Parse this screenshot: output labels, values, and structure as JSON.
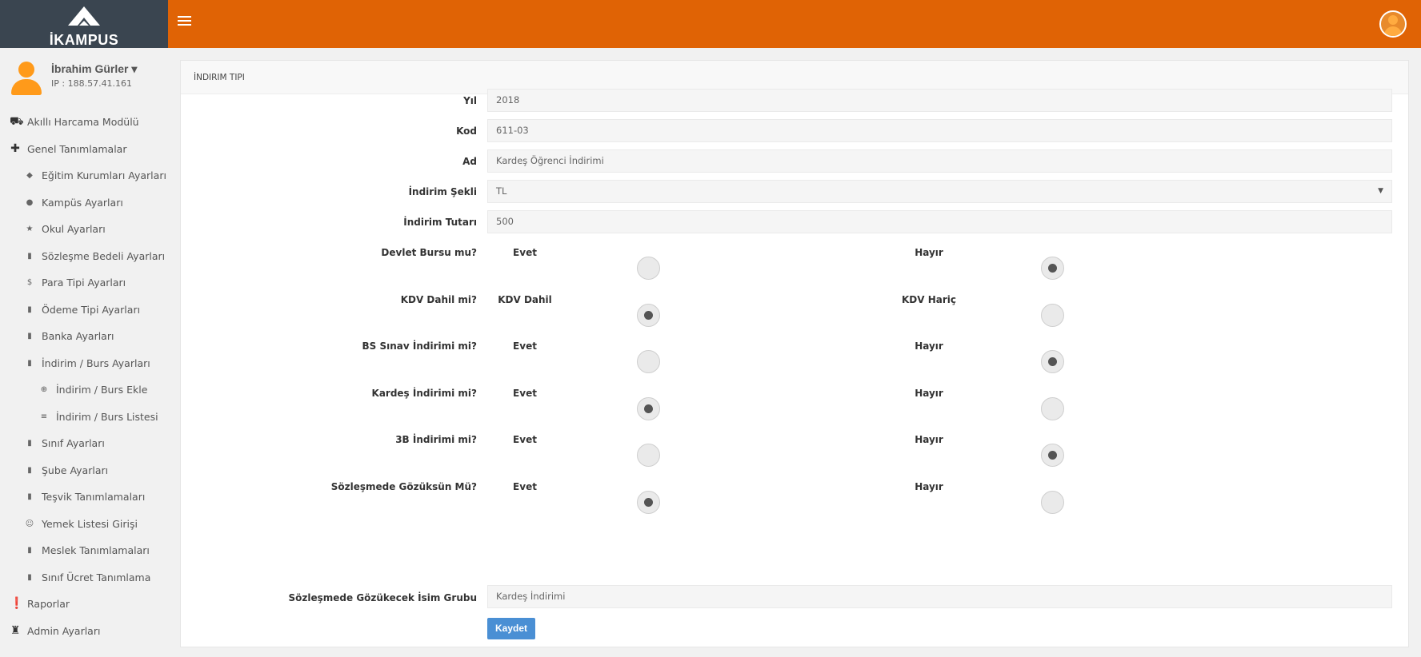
{
  "app": {
    "logo_text": "İKAMPUS"
  },
  "user": {
    "name": "İbrahim Gürler ▾",
    "ip": "IP : 188.57.41.161"
  },
  "sidebar": {
    "items": [
      {
        "label": "Akıllı Harcama Modülü",
        "icon": "basket-icon",
        "glyph": "⛟",
        "level": 0
      },
      {
        "label": "Genel Tanımlamalar",
        "icon": "puzzle-icon",
        "glyph": "✚",
        "level": 0
      },
      {
        "label": "Eğitim Kurumları Ayarları",
        "icon": "graduation-cap-icon",
        "glyph": "◆",
        "level": 1
      },
      {
        "label": "Kampüs Ayarları",
        "icon": "map-marker-icon",
        "glyph": "●",
        "level": 1
      },
      {
        "label": "Okul Ayarları",
        "icon": "star-icon",
        "glyph": "★",
        "level": 1
      },
      {
        "label": "Sözleşme Bedeli Ayarları",
        "icon": "bookmark-icon",
        "glyph": "▮",
        "level": 1
      },
      {
        "label": "Para Tipi Ayarları",
        "icon": "dollar-icon",
        "glyph": "$",
        "level": 1
      },
      {
        "label": "Ödeme Tipi Ayarları",
        "icon": "bookmark-icon",
        "glyph": "▮",
        "level": 1
      },
      {
        "label": "Banka Ayarları",
        "icon": "bookmark-icon",
        "glyph": "▮",
        "level": 1
      },
      {
        "label": "İndirim / Burs Ayarları",
        "icon": "bookmark-icon",
        "glyph": "▮",
        "level": 1
      },
      {
        "label": "İndirim / Burs Ekle",
        "icon": "plus-circle-icon",
        "glyph": "⊕",
        "level": 2
      },
      {
        "label": "İndirim / Burs Listesi",
        "icon": "list-icon",
        "glyph": "≡",
        "level": 2
      },
      {
        "label": "Sınıf Ayarları",
        "icon": "bookmark-icon",
        "glyph": "▮",
        "level": 1
      },
      {
        "label": "Şube Ayarları",
        "icon": "bookmark-icon",
        "glyph": "▮",
        "level": 1
      },
      {
        "label": "Teşvik Tanımlamaları",
        "icon": "bookmark-icon",
        "glyph": "▮",
        "level": 1
      },
      {
        "label": "Yemek Listesi Girişi",
        "icon": "smile-icon",
        "glyph": "☺",
        "level": 1
      },
      {
        "label": "Meslek Tanımlamaları",
        "icon": "bookmark-icon",
        "glyph": "▮",
        "level": 1
      },
      {
        "label": "Sınıf Ücret Tanımlama",
        "icon": "bookmark-icon",
        "glyph": "▮",
        "level": 1
      },
      {
        "label": "Raporlar",
        "icon": "exclamation-circle-icon",
        "glyph": "❗",
        "level": 0
      },
      {
        "label": "Admin Ayarları",
        "icon": "android-icon",
        "glyph": "♜",
        "level": 0
      }
    ]
  },
  "panel": {
    "title": "İNDIRIM TIPI"
  },
  "form": {
    "fields": [
      {
        "label": "Yıl",
        "value": "2018"
      },
      {
        "label": "Kod",
        "value": "611-03"
      },
      {
        "label": "Ad",
        "value": "Kardeş Öğrenci İndirimi"
      },
      {
        "label": "İndirim Şekli",
        "value": "TL",
        "type": "select"
      },
      {
        "label": "İndirim Tutarı",
        "value": "500"
      }
    ],
    "radios": [
      {
        "label": "Devlet Bursu mu?",
        "opt1": "Evet",
        "opt2": "Hayır",
        "selected": "opt2"
      },
      {
        "label": "KDV Dahil mi?",
        "opt1": "KDV Dahil",
        "opt2": "KDV Hariç",
        "selected": "opt1"
      },
      {
        "label": "BS Sınav İndirimi mi?",
        "opt1": "Evet",
        "opt2": "Hayır",
        "selected": "opt2"
      },
      {
        "label": "Kardeş İndirimi mi?",
        "opt1": "Evet",
        "opt2": "Hayır",
        "selected": "opt1"
      },
      {
        "label": "3B İndirimi mi?",
        "opt1": "Evet",
        "opt2": "Hayır",
        "selected": "opt2"
      },
      {
        "label": "Sözleşmede Gözüksün Mü?",
        "opt1": "Evet",
        "opt2": "Hayır",
        "selected": "opt1"
      }
    ],
    "group_label": "Sözleşmede Gözükecek İsim Grubu",
    "group_value": "Kardeş İndirimi",
    "save_label": "Kaydet"
  },
  "colors": {
    "header": "#e06305",
    "logo_bg": "#3a4550",
    "button": "#4a8fd4",
    "avatar": "#ff9a1a"
  }
}
